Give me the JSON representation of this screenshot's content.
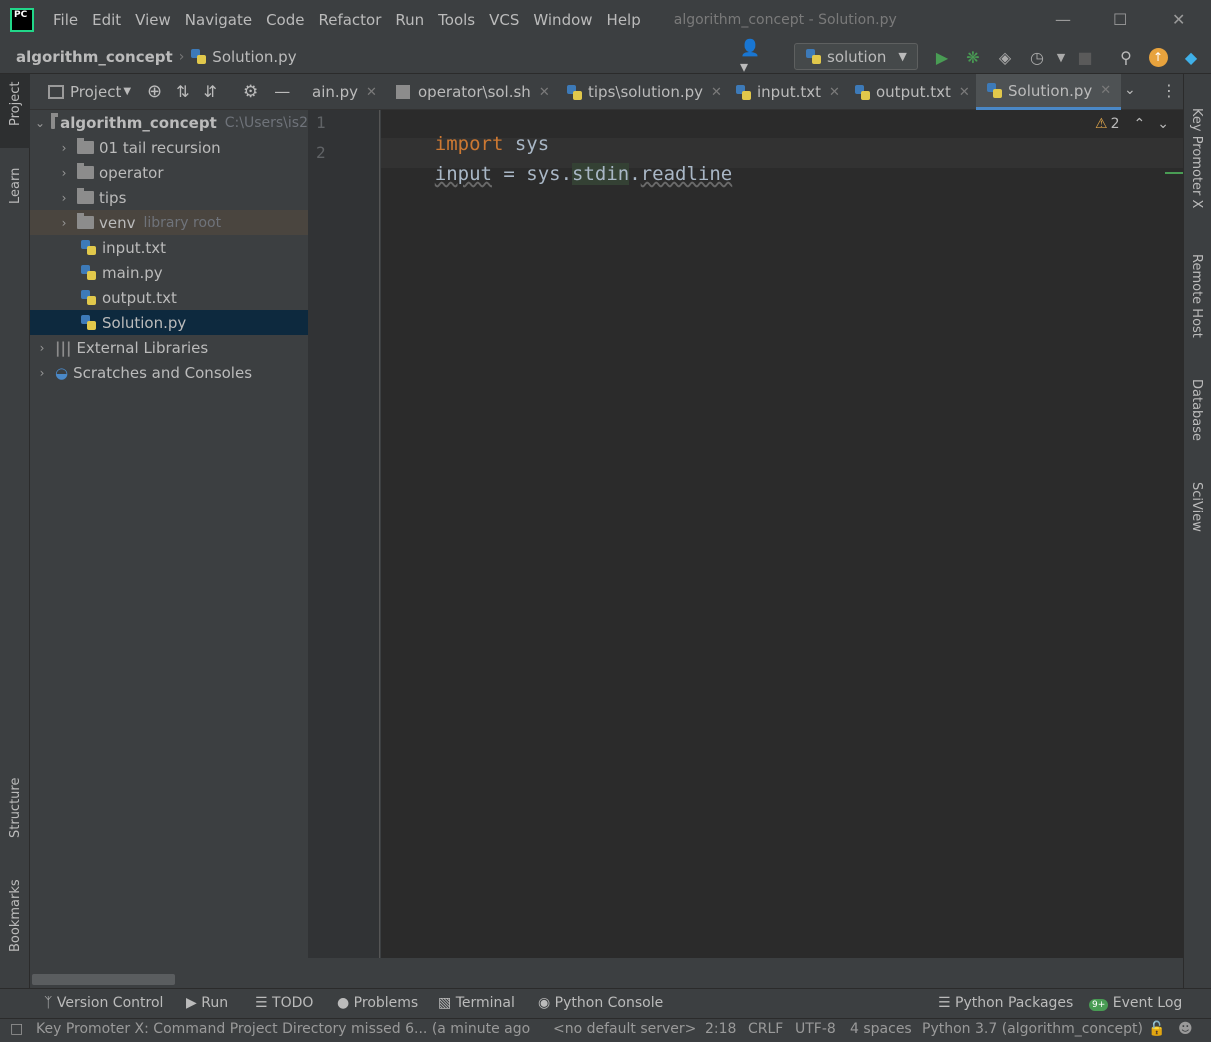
{
  "menubar": {
    "logo": "PC",
    "items": [
      "File",
      "Edit",
      "View",
      "Navigate",
      "Code",
      "Refactor",
      "Run",
      "Tools",
      "VCS",
      "Window",
      "Help"
    ],
    "window_title": "algorithm_concept - Solution.py"
  },
  "navbar": {
    "project": "algorithm_concept",
    "file": "Solution.py",
    "run_config": "solution"
  },
  "project_panel": {
    "title": "Project",
    "root": {
      "name": "algorithm_concept",
      "path": "C:\\Users\\is2"
    },
    "folders": [
      "01 tail recursion",
      "operator",
      "tips"
    ],
    "venv": {
      "name": "venv",
      "hint": "library root"
    },
    "files": [
      "input.txt",
      "main.py",
      "output.txt",
      "Solution.py"
    ],
    "external": "External Libraries",
    "scratches": "Scratches and Consoles"
  },
  "left_strip": {
    "project": "Project",
    "learn": "Learn",
    "structure": "Structure",
    "bookmarks": "Bookmarks"
  },
  "right_strip": {
    "key_promoter": "Key Promoter X",
    "remote_host": "Remote Host",
    "database": "Database",
    "sciview": "SciView"
  },
  "tabs": [
    {
      "label": "ain.py"
    },
    {
      "label": "operator\\sol.sh"
    },
    {
      "label": "tips\\solution.py"
    },
    {
      "label": "input.txt"
    },
    {
      "label": "output.txt"
    },
    {
      "label": "Solution.py",
      "active": true
    }
  ],
  "editor": {
    "line_numbers": [
      "1",
      "2"
    ],
    "line1": {
      "kw": "import",
      "rest": " sys"
    },
    "line2": {
      "a": "input",
      "b": " = sys.",
      "c": "stdin",
      "d": ".",
      "e": "readline"
    },
    "warnings": "2"
  },
  "tool_windows": [
    "Version Control",
    "Run",
    "TODO",
    "Problems",
    "Terminal",
    "Python Console",
    "Python Packages",
    "Event Log"
  ],
  "event_badge": "9+",
  "status": {
    "message": "Key Promoter X: Command Project Directory missed 6... (a minute ago",
    "server": "<no default server>",
    "position": "2:18",
    "line_sep": "CRLF",
    "encoding": "UTF-8",
    "indent": "4 spaces",
    "interpreter": "Python 3.7 (algorithm_concept)"
  },
  "colors": {
    "keyword": "#cc7832",
    "text": "#a9b7c6",
    "selection": "#0d293e",
    "run": "#499c54"
  }
}
